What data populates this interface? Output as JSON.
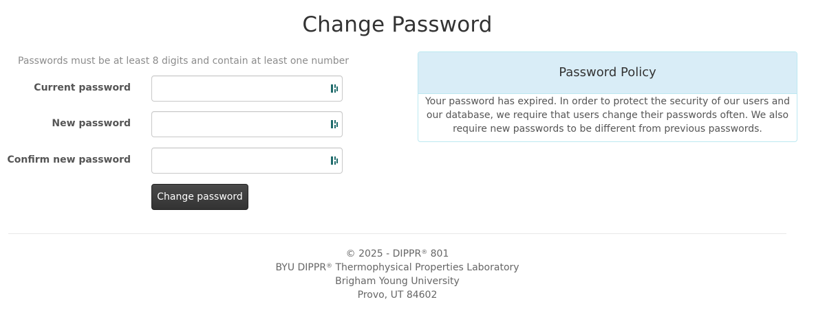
{
  "page": {
    "title": "Change Password"
  },
  "form": {
    "hint": "Passwords must be at least 8 digits and contain at least one number",
    "fields": [
      {
        "label": "Current password",
        "value": "",
        "placeholder": ""
      },
      {
        "label": "New password",
        "value": "",
        "placeholder": ""
      },
      {
        "label": "Confirm new password",
        "value": "",
        "placeholder": ""
      }
    ],
    "submit_label": "Change password",
    "password_manager_icon": "password-manager-icon",
    "icon_color": "#1f6b6b"
  },
  "policy": {
    "heading": "Password Policy",
    "body": "Your password has expired. In order to protect the security of our users and our database, we require that users change their passwords often. We also require new passwords to be different from previous passwords.",
    "heading_bg": "#d9edf7",
    "border_color": "#bce8f1"
  },
  "footer": {
    "copyright_prefix": "© 2025 - DIPPR",
    "copyright_mark": "®",
    "copyright_suffix": " 801",
    "lab_prefix": "BYU DIPPR",
    "lab_mark": "®",
    "lab_suffix": " Thermophysical Properties Laboratory",
    "university": "Brigham Young University",
    "address": "Provo, UT 84602"
  }
}
